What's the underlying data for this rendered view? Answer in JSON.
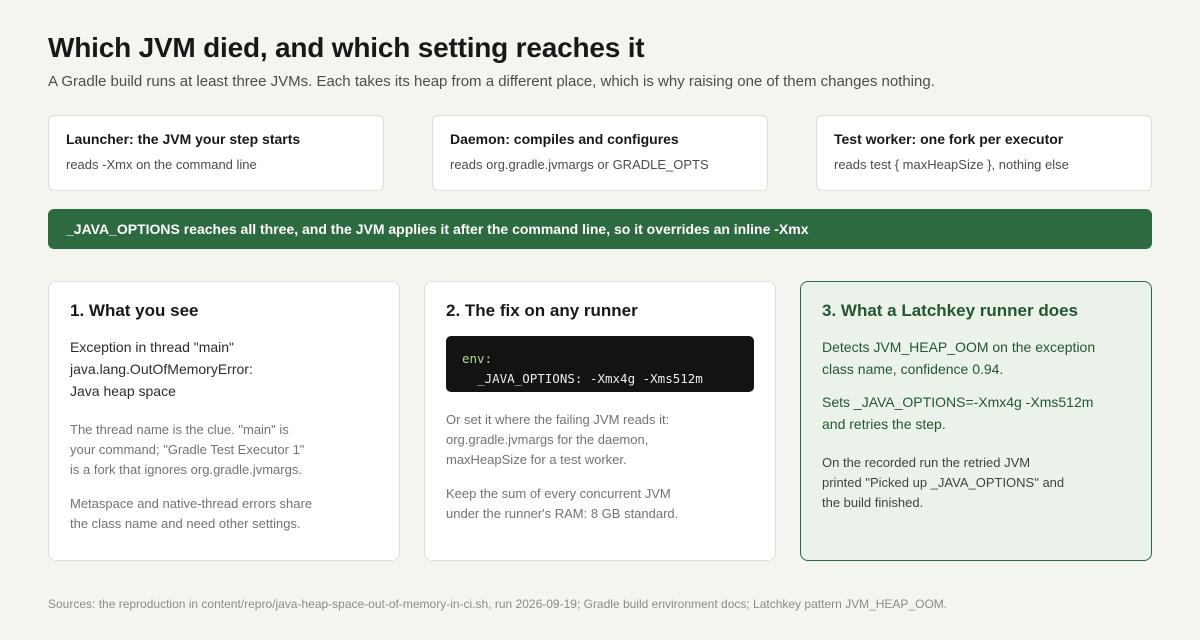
{
  "header": {
    "title": "Which JVM died, and which setting reaches it",
    "subtitle": "A Gradle build runs at least three JVMs. Each takes its heap from a different place, which is why raising one of them changes nothing."
  },
  "jvms": [
    {
      "name": "Launcher: the JVM your step starts",
      "reads": "reads -Xmx on the command line"
    },
    {
      "name": "Daemon: compiles and configures",
      "reads": "reads org.gradle.jvmargs or GRADLE_OPTS"
    },
    {
      "name": "Test worker: one fork per executor",
      "reads": "reads test { maxHeapSize }, nothing else"
    }
  ],
  "banner": {
    "text": "_JAVA_OPTIONS reaches all three, and the JVM applies it after the command line, so it overrides an inline -Xmx"
  },
  "steps": {
    "see": {
      "title": "1. What you see",
      "error_lines": [
        "Exception in thread \"main\"",
        "java.lang.OutOfMemoryError:",
        "Java heap space"
      ],
      "clue_lines": [
        "The thread name is the clue. \"main\" is",
        "your command; \"Gradle Test Executor 1\"",
        "is a fork that ignores org.gradle.jvmargs."
      ],
      "note_lines": [
        "Metaspace and native-thread errors share",
        "the class name and need other settings."
      ]
    },
    "fix": {
      "title": "2. The fix on any runner",
      "code_key": "env:",
      "code_value": "  _JAVA_OPTIONS: -Xmx4g -Xms512m",
      "alt_lines": [
        "Or set it where the failing JVM reads it:",
        "org.gradle.jvmargs for the daemon,",
        "maxHeapSize for a test worker."
      ],
      "ram_lines": [
        "Keep the sum of every concurrent JVM",
        "under the runner's RAM: 8 GB standard."
      ]
    },
    "latchkey": {
      "title": "3. What a Latchkey runner does",
      "detect_lines": [
        "Detects JVM_HEAP_OOM on the exception",
        "class name, confidence 0.94."
      ],
      "set_lines": [
        "Sets _JAVA_OPTIONS=-Xmx4g -Xms512m",
        "and retries the step."
      ],
      "result_lines": [
        "On the recorded run the retried JVM",
        "printed \"Picked up _JAVA_OPTIONS\" and",
        "the build finished."
      ]
    }
  },
  "footer": {
    "sources": "Sources: the reproduction in content/repro/java-heap-space-out-of-memory-in-ci.sh, run 2026-09-19; Gradle build environment docs; Latchkey pattern JVM_HEAP_OOM."
  }
}
